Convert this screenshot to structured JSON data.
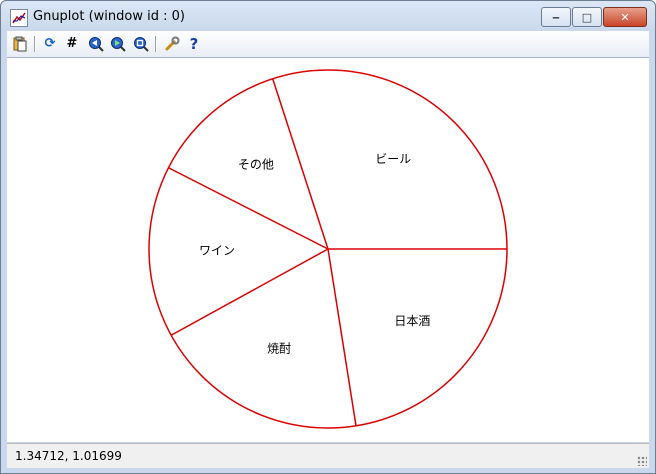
{
  "window": {
    "title": "Gnuplot (window id : 0)",
    "buttons": {
      "minimize": "‒",
      "maximize": "□",
      "close": "✕"
    }
  },
  "toolbar": {
    "icons": [
      "copy-to-clipboard-icon",
      "replot-icon",
      "grid-icon",
      "zoom-previous-icon",
      "zoom-next-icon",
      "unzoom-icon",
      "options-icon",
      "help-icon"
    ],
    "glyphs": {
      "replot": "⟳",
      "grid": "#",
      "zoom_previous": "◀",
      "zoom_next": "▶",
      "unzoom": "⊡",
      "options": "🔧",
      "help": "?"
    }
  },
  "status": {
    "coords": "1.34712,  1.01699"
  },
  "colors": {
    "pie_stroke": "#dd0000",
    "background": "#ffffff"
  },
  "chart_data": {
    "type": "pie",
    "categories": [
      "ビール",
      "その他",
      "ワイン",
      "焼酎",
      "日本酒"
    ],
    "values": [
      30,
      12.5,
      15.5,
      19.5,
      22.5
    ],
    "start_angle_deg": 0,
    "direction": "counterclockwise",
    "fill": "none",
    "title": ""
  }
}
